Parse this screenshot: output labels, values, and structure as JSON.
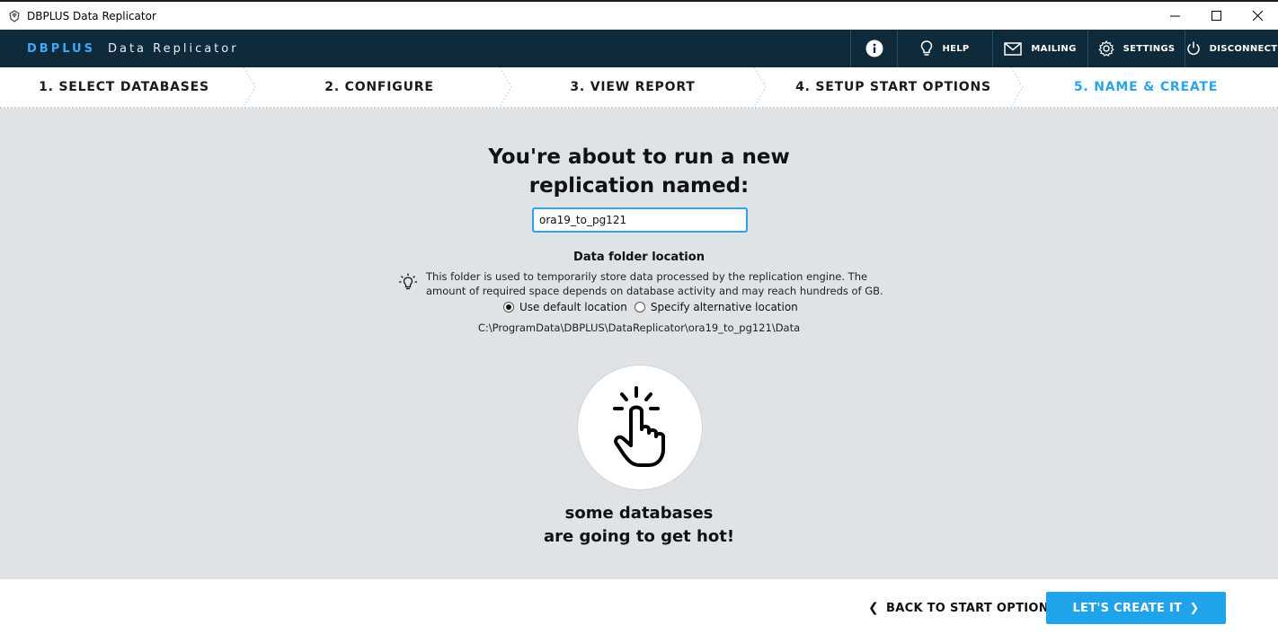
{
  "window": {
    "title": "DBPLUS Data Replicator",
    "controls": [
      "minimize-icon",
      "maximize-icon",
      "close-icon"
    ]
  },
  "header": {
    "brand_primary": "DBPLUS",
    "brand_secondary": "Data Replicator",
    "actions": {
      "info_icon": "info-icon",
      "help": "HELP",
      "mailing": "MAILING",
      "settings": "SETTINGS",
      "disconnect": "DISCONNECT"
    }
  },
  "steps": [
    {
      "label": "1. SELECT DATABASES",
      "active": false
    },
    {
      "label": "2. CONFIGURE",
      "active": false
    },
    {
      "label": "3. VIEW REPORT",
      "active": false
    },
    {
      "label": "4. SETUP START OPTIONS",
      "active": false
    },
    {
      "label": "5. NAME & CREATE",
      "active": true
    }
  ],
  "main": {
    "heading_line1": "You're about to run a new",
    "heading_line2": "replication named:",
    "replication_name": "ora19_to_pg121",
    "folder_title": "Data folder location",
    "folder_description": "This folder is used to temporarily store data processed by the replication engine. The amount of required space depends on database activity and may reach hundreds of GB.",
    "radio_default": "Use default location",
    "radio_alternative": "Specify alternative location",
    "selected_option": "Use default location",
    "folder_path": "C:\\ProgramData\\DBPLUS\\DataReplicator\\ora19_to_pg121\\Data",
    "tagline_line1": "some databases",
    "tagline_line2": "are going to get hot!"
  },
  "footer": {
    "back_label": "BACK TO START OPTIONS",
    "create_label": "LET'S CREATE IT"
  },
  "colors": {
    "accent": "#1fa3ea",
    "header_bg": "#0f2a3b",
    "overlay_bg": "#dfe3e6"
  }
}
